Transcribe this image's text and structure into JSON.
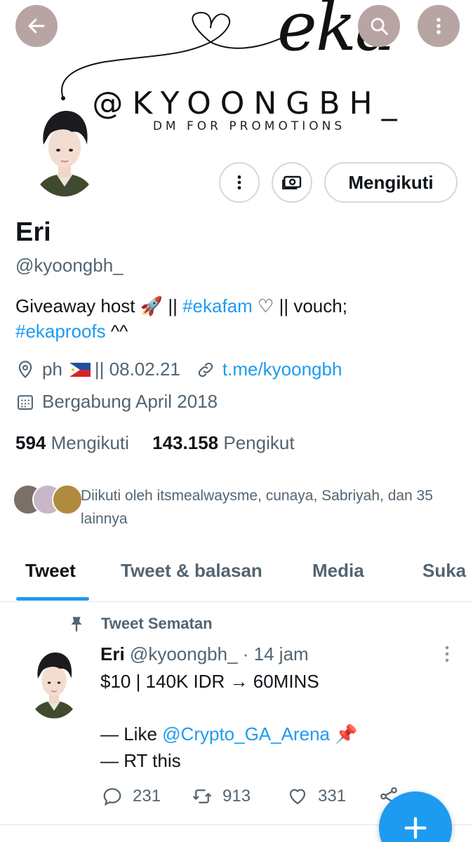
{
  "banner": {
    "script_text": "eka",
    "handle_text": "@KYOONGBH_",
    "subtitle": "DM FOR PROMOTIONS"
  },
  "topbar": {
    "back_icon": "arrow-left-icon",
    "search_icon": "search-icon",
    "more_icon": "more-vertical-icon"
  },
  "profile": {
    "name": "Eri",
    "handle": "@kyoongbh_",
    "bio_text1": "Giveaway host ",
    "bio_emoji": "🚀",
    "bio_sep1": " || ",
    "bio_tag1": "#ekafam",
    "bio_text2": " ♡ || vouch;",
    "bio_tag2": "#ekaproofs",
    "bio_text3": " ^^",
    "location": "ph",
    "location_tail": "|| 08.02.21",
    "url": "t.me/kyoongbh",
    "joined": "Bergabung April 2018",
    "following_count": "594",
    "following_label": "Mengikuti",
    "followers_count": "143.158",
    "followers_label": "Pengikut",
    "followed_by": "Diikuti oleh itsmealwaysme, cunaya, Sabriyah, dan 35 lainnya",
    "follow_button": "Mengikuti"
  },
  "tabs": [
    {
      "label": "Tweet",
      "active": true
    },
    {
      "label": "Tweet & balasan",
      "active": false
    },
    {
      "label": "Media",
      "active": false
    },
    {
      "label": "Suka",
      "active": false
    }
  ],
  "tweet": {
    "pinned_label": "Tweet Sematan",
    "author_name": "Eri",
    "author_handle": "@kyoongbh_",
    "time": "· 14 jam",
    "line1": "$10 | 140K IDR → 60MINS",
    "line2_prefix": "— Like ",
    "line2_mention": "@Crypto_GA_Arena",
    "line2_emoji": "📌",
    "line3": "— RT this",
    "replies": "231",
    "retweets": "913",
    "likes": "331"
  },
  "colors": {
    "accent": "#1d9bf0",
    "muted": "#536471",
    "topbar_button": "#b9a4a4"
  }
}
